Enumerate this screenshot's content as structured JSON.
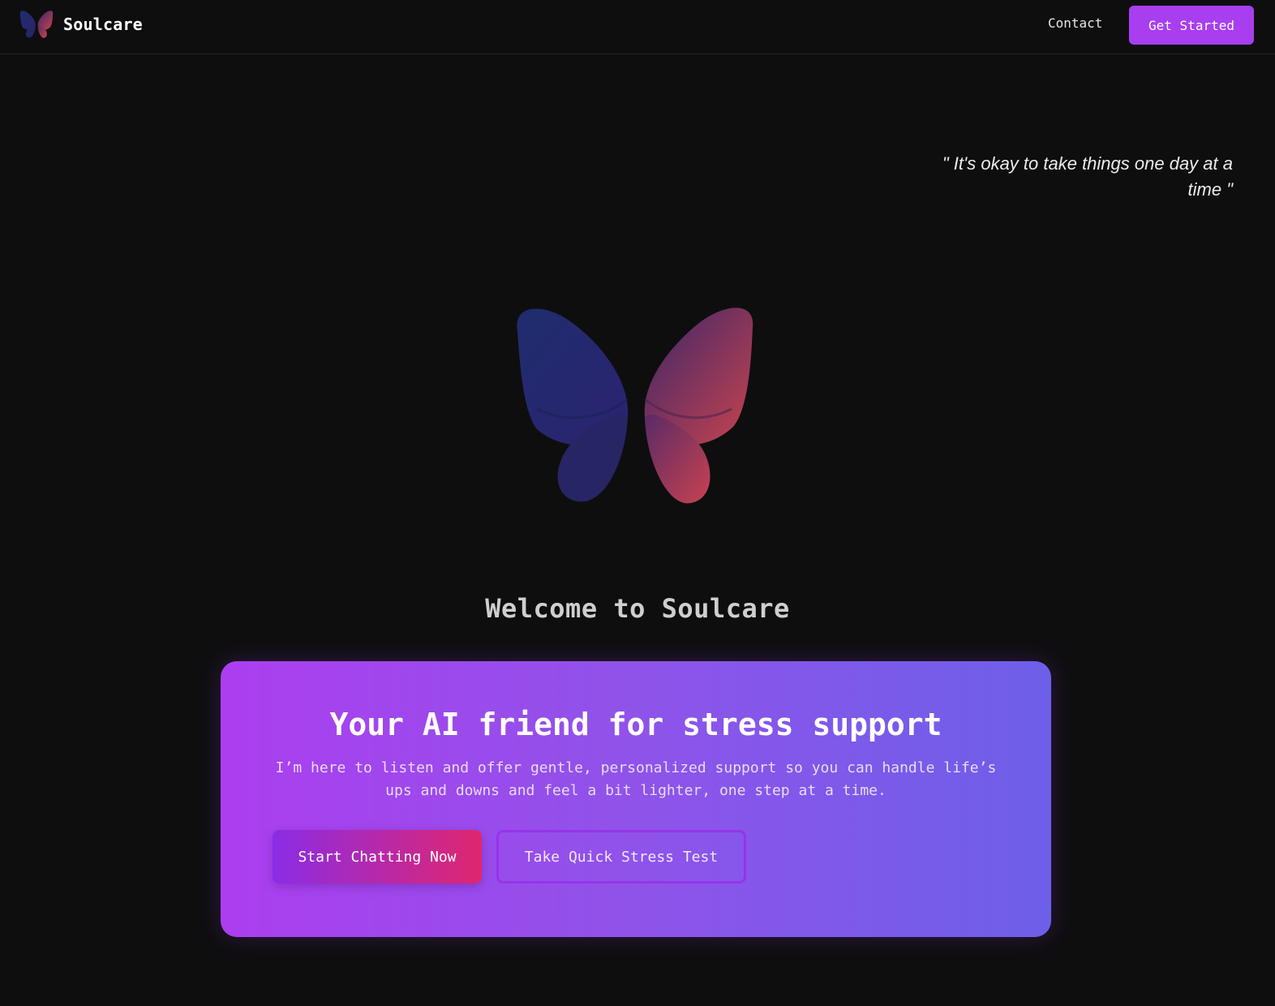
{
  "navbar": {
    "brand_name": "Soulcare",
    "brand_logo_icon": "butterfly-icon",
    "contact_label": "Contact",
    "cta_label": "Get Started",
    "cta_color": "#a83ef0"
  },
  "hero": {
    "quote": "\" It's okay to take things one day at a time \"",
    "logo_icon": "butterfly-icon",
    "welcome_text": "Welcome to Soulcare"
  },
  "card": {
    "title": "Your AI friend for stress support",
    "subtitle": "I’m here to listen and offer gentle, personalized support so you can handle life’s ups and downs and feel a bit lighter, one step at a time.",
    "primary_button_label": "Start Chatting Now",
    "secondary_button_label": "Take Quick Stress Test",
    "gradient_start": "#ac3eef",
    "gradient_end": "#6d5fe9"
  }
}
